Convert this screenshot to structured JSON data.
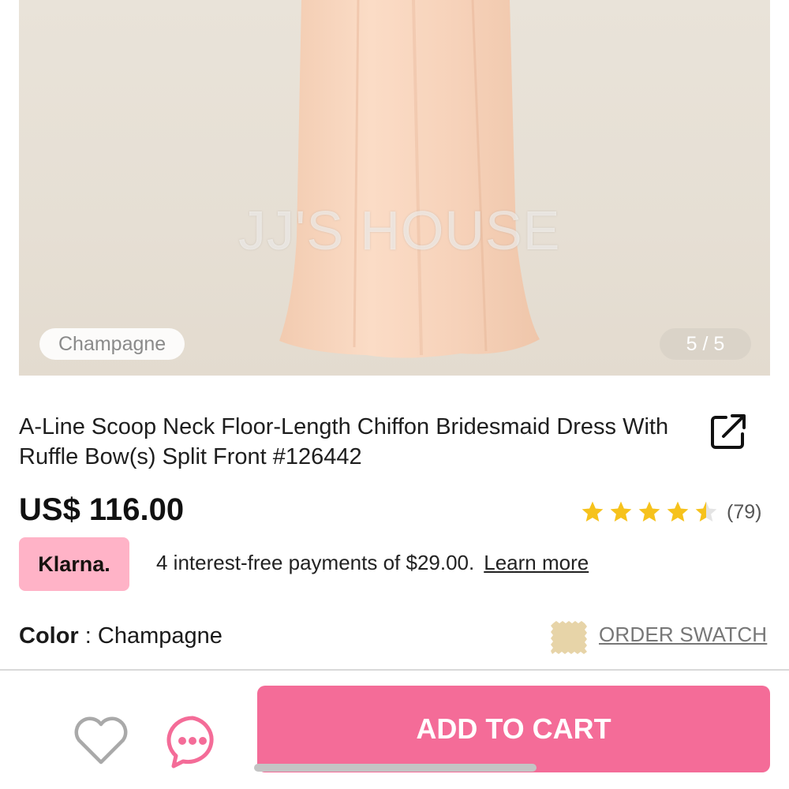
{
  "gallery": {
    "watermark": "JJ'S HOUSE",
    "color_label": "Champagne",
    "counter": "5 / 5"
  },
  "product": {
    "title": "A-Line Scoop Neck Floor-Length Chiffon Bridesmaid Dress With Ruffle Bow(s) Split Front #126442",
    "price": "US$ 116.00",
    "rating": 4.5,
    "rating_count": "(79)"
  },
  "klarna": {
    "badge": "Klarna.",
    "message": "4 interest-free payments of $29.00.",
    "learn_more": "Learn more"
  },
  "color": {
    "label": "Color",
    "separator": " : ",
    "value": "Champagne",
    "order_swatch": "ORDER SWATCH"
  },
  "actions": {
    "add_to_cart": "ADD TO CART"
  },
  "icons": {
    "share": "share-icon",
    "star": "star-icon",
    "heart": "heart-icon",
    "chat": "chat-icon",
    "swatch": "fabric-swatch-icon"
  },
  "colors": {
    "accent": "#f46c98",
    "klarna_pink": "#ffb3c7",
    "star_gold": "#f6c21c",
    "swatch": "#e7d4a8"
  }
}
